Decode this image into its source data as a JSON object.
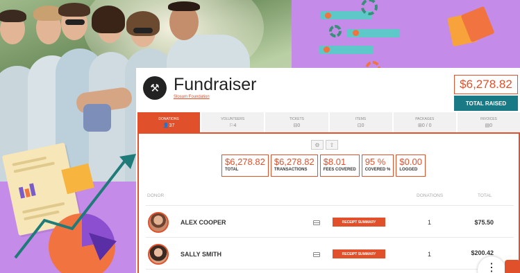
{
  "app": {
    "title": "Fundraiser",
    "organization": "Slosum Foundation",
    "total_raised_amount": "$6,278.82",
    "total_raised_label": "TOTAL RAISED"
  },
  "tabs": [
    {
      "label": "DONATIONS",
      "icon": "donor-icon",
      "badge": "37",
      "active": true
    },
    {
      "label": "VOLUNTEERS",
      "icon": "volunteers-icon",
      "badge": "4",
      "active": false
    },
    {
      "label": "TICKETS",
      "icon": "tickets-icon",
      "badge": "0",
      "active": false
    },
    {
      "label": "ITEMS",
      "icon": "items-icon",
      "badge": "0",
      "active": false
    },
    {
      "label": "PACKAGES",
      "icon": "packages-icon",
      "badge": "0 / 0",
      "active": false
    },
    {
      "label": "INVOICES",
      "icon": "invoices-icon",
      "badge": "0",
      "active": false
    }
  ],
  "stats": [
    {
      "value": "$6,278.82",
      "label": "TOTAL"
    },
    {
      "value": "$6,278.82",
      "label": "TRANSACTIONS"
    },
    {
      "value": "$8.01",
      "label": "FEES COVERED"
    },
    {
      "value": "95 %",
      "label": "COVERED %"
    },
    {
      "value": "$0.00",
      "label": "LOGGED"
    }
  ],
  "table": {
    "headers": {
      "donor": "DONOR",
      "donations": "DONATIONS",
      "total": "TOTAL"
    },
    "receipt_label": "RECEIPT SUMMARY",
    "rows": [
      {
        "name": "ALEX COOPER",
        "donations": "1",
        "total": "$75.50"
      },
      {
        "name": "SALLY SMITH",
        "donations": "1",
        "total": "$200.42"
      }
    ]
  },
  "colors": {
    "accent": "#e0502b",
    "teal": "#197a86",
    "background_purple": "#c58be8"
  }
}
